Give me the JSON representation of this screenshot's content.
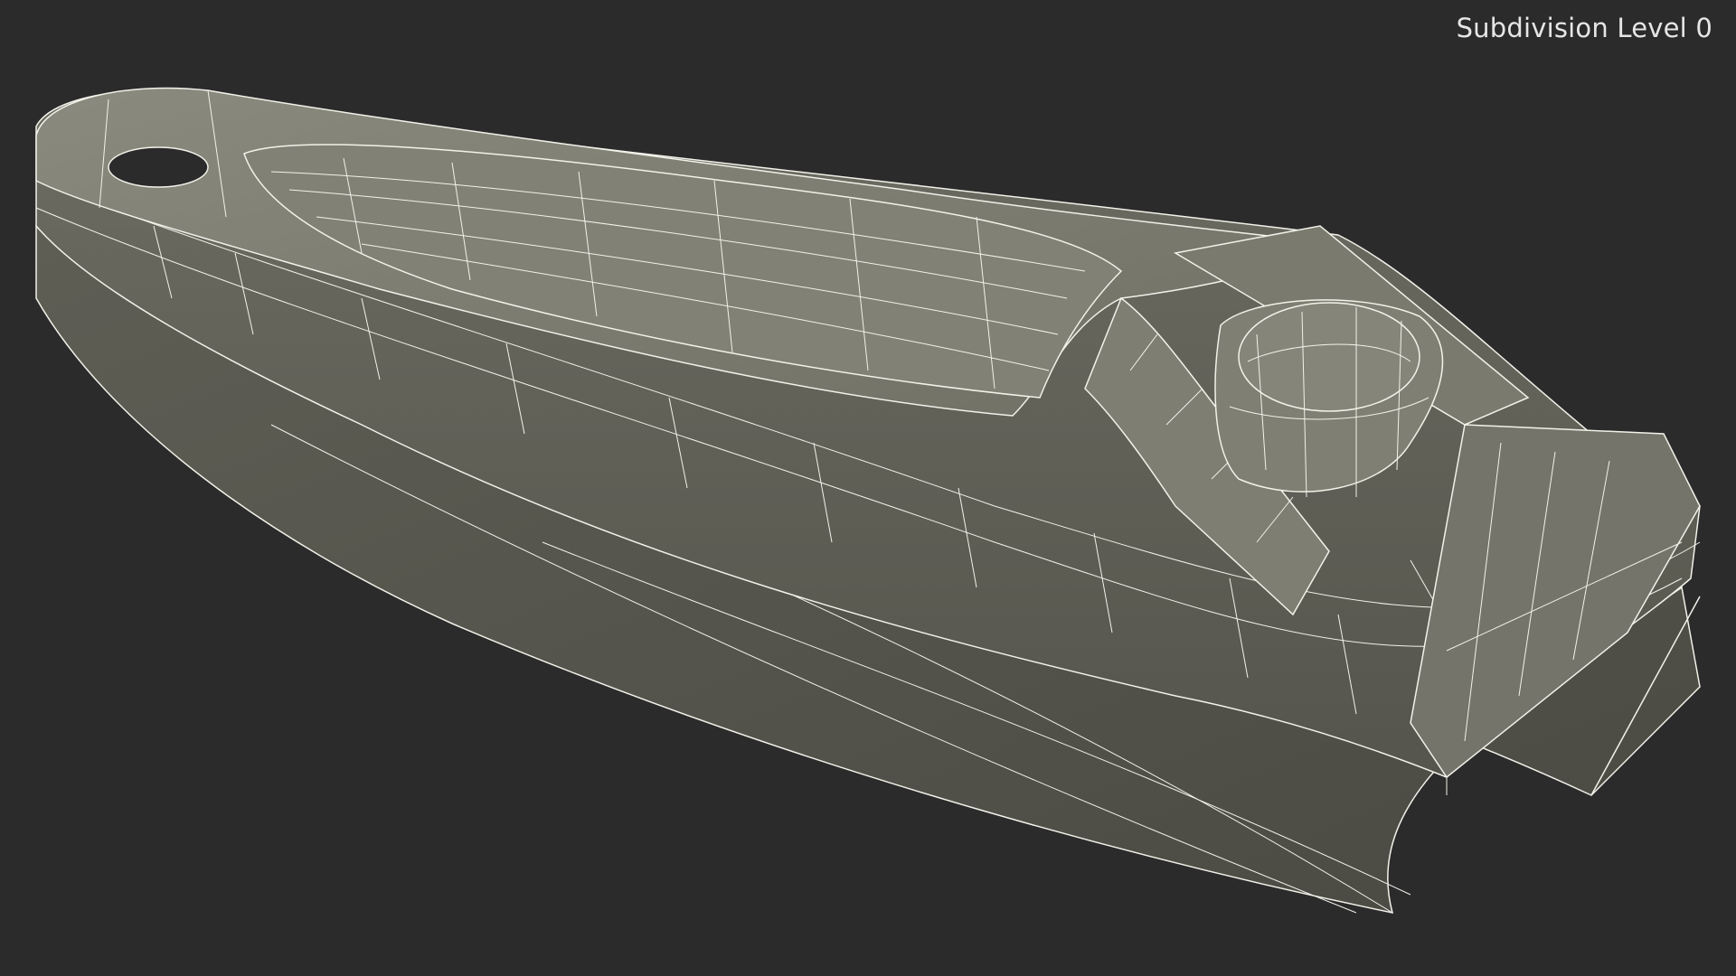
{
  "viewport": {
    "subdivision_label": "Subdivision Level 0",
    "background_color": "#2b2b2b",
    "mesh_fill_color": "#7a7a6e",
    "wire_color": "#f2f2ea"
  },
  "subject": {
    "icon": "nail-clipper-wireframe"
  }
}
